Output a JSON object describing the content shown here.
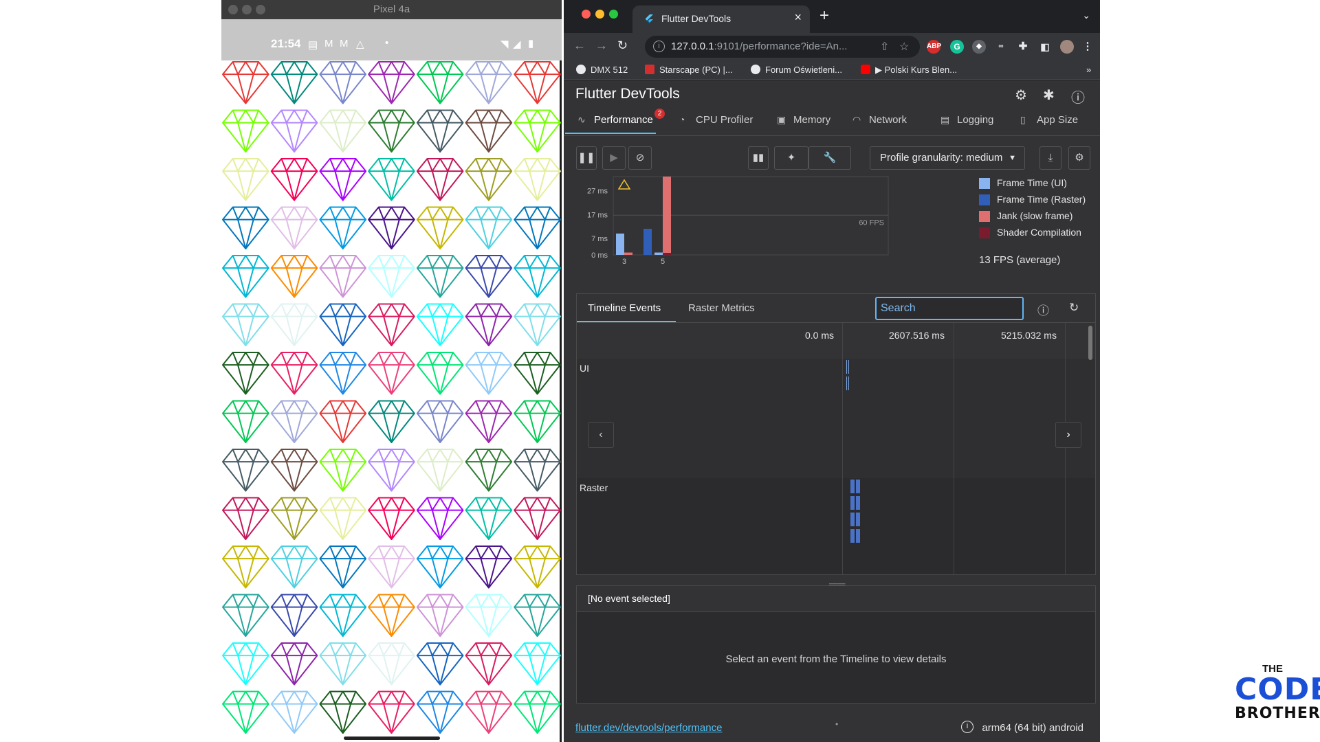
{
  "colors": {
    "ui_frame": "#8ab4f0",
    "raster_frame": "#2f5fb8",
    "jank": "#e07070",
    "shader": "#7a1c2e",
    "accent": "#4fc3f7"
  },
  "emulator": {
    "title": "Pixel 4a",
    "status": {
      "time": "21:54"
    },
    "diamond_colors": [
      "#e53935",
      "#8e24aa",
      "#039be5",
      "#6d4c41",
      "#00e676",
      "#fb8c00",
      "#c2185b",
      "#00897b",
      "#80deea",
      "#4a148c",
      "#76ff03",
      "#90caf9",
      "#ce93d8",
      "#9e9d24",
      "#7986cb",
      "#e0f2f1",
      "#c6b700",
      "#b388ff",
      "#1b5e20",
      "#b2ffff",
      "#e6ee9c",
      "#9c27b0",
      "#1565c0",
      "#4dd0e1",
      "#dcedc8",
      "#e91e63",
      "#26a69a",
      "#f50057",
      "#00c853",
      "#d81b60",
      "#0277bd",
      "#2e7d32",
      "#1e88e5",
      "#3949ab",
      "#aa00ff",
      "#9fa8da",
      "#18ffff",
      "#e1bee7",
      "#455a64",
      "#ec407a",
      "#00b8d4",
      "#00bfa5"
    ]
  },
  "browser": {
    "tab": {
      "title": "Flutter DevTools"
    },
    "address": {
      "host": "127.0.0.1",
      "rest": ":9101/performance?ide=An..."
    },
    "bookmarks": [
      "DMX 512",
      "Starscape (PC) |...",
      "Forum Oświetleni...",
      "▶ Polski Kurs Blen..."
    ],
    "bookmarks_more": "»",
    "extensions": {
      "abp": "ABP",
      "grammarly": "G"
    }
  },
  "devtools": {
    "title": "Flutter DevTools",
    "tabs": [
      {
        "label": "Performance",
        "badge": "2"
      },
      {
        "label": "CPU Profiler"
      },
      {
        "label": "Memory"
      },
      {
        "label": "Network"
      },
      {
        "label": "Logging"
      },
      {
        "label": "App Size"
      }
    ],
    "controls": {
      "granularity": "Profile granularity: medium"
    },
    "legend": [
      {
        "label": "Frame Time (UI)",
        "color": "#8ab4f0"
      },
      {
        "label": "Frame Time (Raster)",
        "color": "#2f5fb8"
      },
      {
        "label": "Jank (slow frame)",
        "color": "#e07070"
      },
      {
        "label": "Shader Compilation",
        "color": "#7a1c2e"
      }
    ],
    "fps_average": "13 FPS (average)",
    "timeline": {
      "tabs": [
        "Timeline Events",
        "Raster Metrics"
      ],
      "search_placeholder": "Search",
      "ticks": [
        "0.0 ms",
        "2607.516 ms",
        "5215.032 ms"
      ],
      "tracks": [
        "UI",
        "Raster"
      ]
    },
    "details": {
      "title": "[No event selected]",
      "empty_text": "Select an event from the Timeline to view details"
    },
    "status": {
      "link": "flutter.dev/devtools/performance",
      "device": "arm64 (64 bit) android"
    }
  },
  "chart_data": {
    "type": "bar",
    "y_tick_labels": [
      "27 ms",
      "17 ms",
      "7 ms",
      "0 ms"
    ],
    "y_ticks": [
      27,
      17,
      7,
      0
    ],
    "ylim": [
      0,
      33
    ],
    "x_tick_labels": [
      "3",
      "5"
    ],
    "target_line": {
      "value": 16.7,
      "label": "60 FPS"
    },
    "frames": [
      {
        "id": 3,
        "ui": 9,
        "raster": 1,
        "jank": true
      },
      {
        "id": 4,
        "ui": 0,
        "raster": 11,
        "jank": false
      },
      {
        "id": 5,
        "ui": 1,
        "raster": 33,
        "jank": true
      }
    ],
    "warning_frame": 3
  },
  "logo": {
    "line1": "THE",
    "line2": "CODE",
    "line3": "BROTHERS"
  }
}
